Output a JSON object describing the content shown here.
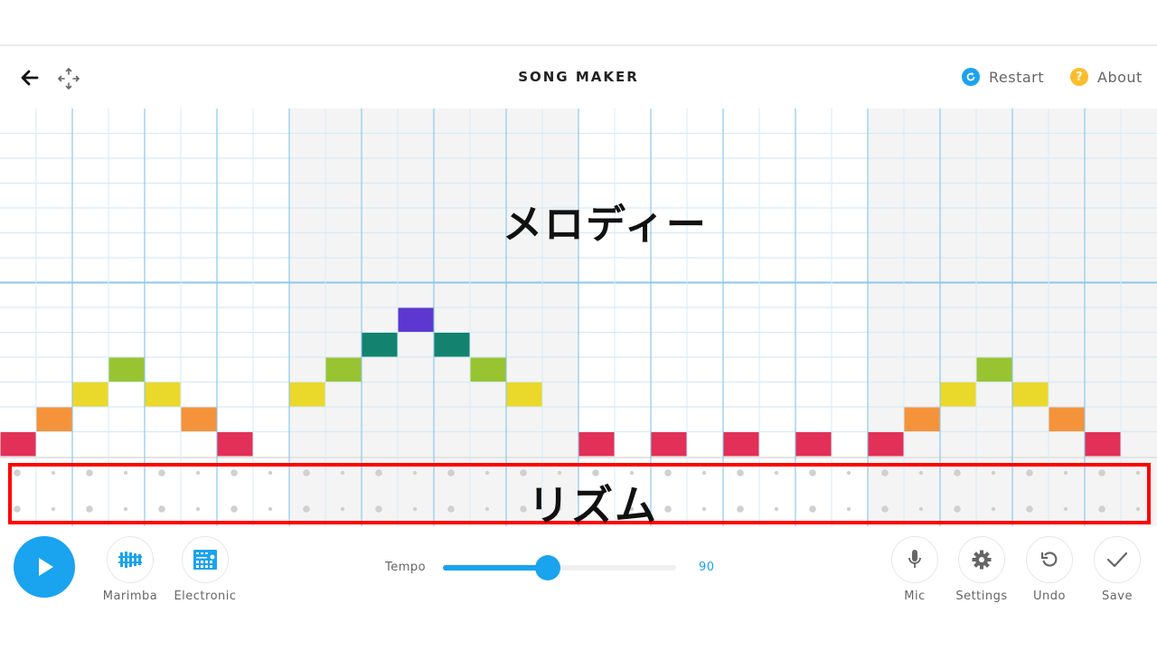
{
  "header": {
    "title": "SONG MAKER",
    "back_icon": "arrow-left-icon",
    "move_icon": "move-arrows-icon",
    "restart": {
      "label": "Restart",
      "icon": "restart-icon",
      "color": "#1aa3ee"
    },
    "about": {
      "label": "About",
      "icon": "question-icon",
      "color": "#fbbd2b"
    }
  },
  "grid": {
    "columns": 32,
    "melody_rows": 14,
    "beats_per_bar": 8,
    "octave_line_row": 7,
    "shaded_bars": [
      1,
      3
    ],
    "colors": {
      "line_major": "#8cc9ea",
      "line_minor": "#d6ebf7",
      "shade": "#f4f4f4",
      "rhythm_dot": "#d0d0d0"
    },
    "notes": [
      {
        "col": 0,
        "row": 13,
        "color": "#e23058"
      },
      {
        "col": 1,
        "row": 12,
        "color": "#f5933b"
      },
      {
        "col": 2,
        "row": 11,
        "color": "#ead82b"
      },
      {
        "col": 3,
        "row": 10,
        "color": "#98c432"
      },
      {
        "col": 4,
        "row": 11,
        "color": "#ead82b"
      },
      {
        "col": 5,
        "row": 12,
        "color": "#f5933b"
      },
      {
        "col": 6,
        "row": 13,
        "color": "#e23058"
      },
      {
        "col": 8,
        "row": 11,
        "color": "#ead82b"
      },
      {
        "col": 9,
        "row": 10,
        "color": "#98c432"
      },
      {
        "col": 10,
        "row": 9,
        "color": "#13836f"
      },
      {
        "col": 11,
        "row": 8,
        "color": "#5d37cf"
      },
      {
        "col": 12,
        "row": 9,
        "color": "#13836f"
      },
      {
        "col": 13,
        "row": 10,
        "color": "#98c432"
      },
      {
        "col": 14,
        "row": 11,
        "color": "#ead82b"
      },
      {
        "col": 16,
        "row": 13,
        "color": "#e23058"
      },
      {
        "col": 18,
        "row": 13,
        "color": "#e23058"
      },
      {
        "col": 20,
        "row": 13,
        "color": "#e23058"
      },
      {
        "col": 22,
        "row": 13,
        "color": "#e23058"
      },
      {
        "col": 24,
        "row": 13,
        "color": "#e23058"
      },
      {
        "col": 25,
        "row": 12,
        "color": "#f5933b"
      },
      {
        "col": 26,
        "row": 11,
        "color": "#ead82b"
      },
      {
        "col": 27,
        "row": 10,
        "color": "#98c432"
      },
      {
        "col": 28,
        "row": 11,
        "color": "#ead82b"
      },
      {
        "col": 29,
        "row": 12,
        "color": "#f5933b"
      },
      {
        "col": 30,
        "row": 13,
        "color": "#e23058"
      }
    ]
  },
  "annotations": {
    "melody": "メロディー",
    "rhythm": "リズム",
    "highlight_color": "#ff0000"
  },
  "toolbar": {
    "play_icon": "play-icon",
    "instruments": [
      {
        "label": "Marimba",
        "icon": "marimba-icon"
      },
      {
        "label": "Electronic",
        "icon": "electronic-drum-icon"
      }
    ],
    "tempo": {
      "label": "Tempo",
      "value": "90",
      "fraction": 0.45
    },
    "actions": [
      {
        "label": "Mic",
        "icon": "mic-icon"
      },
      {
        "label": "Settings",
        "icon": "gear-icon"
      },
      {
        "label": "Undo",
        "icon": "undo-icon"
      },
      {
        "label": "Save",
        "icon": "check-icon"
      }
    ],
    "accent": "#1aa3ee"
  }
}
